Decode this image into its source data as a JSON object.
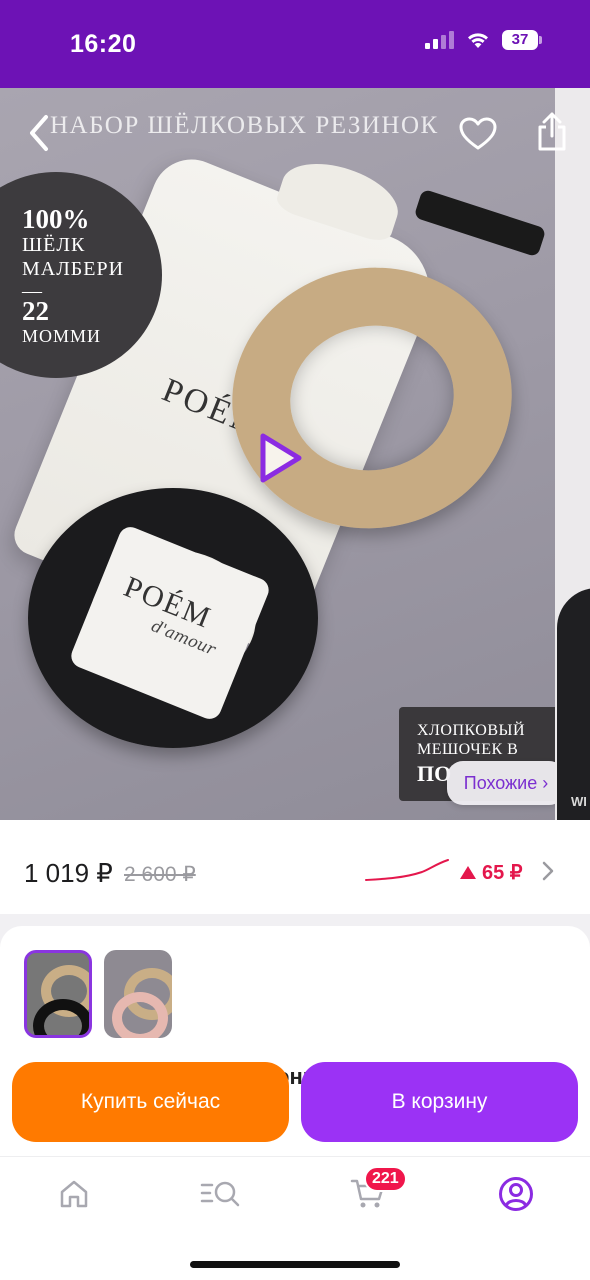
{
  "status_bar": {
    "time": "16:20",
    "battery": "37"
  },
  "product": {
    "photo_title": "НАБОР ШЁЛКОВЫХ РЕЗИНОК",
    "badge": {
      "line1": "100%",
      "line2": "ШЁЛК",
      "line3": "МАЛБЕРИ",
      "line4": "—",
      "line5": "22",
      "line6": "МОММИ"
    },
    "pouch_brand": "POÉM",
    "card_brand": "POÉM",
    "card_sub": "d'amour",
    "pouch_tag": {
      "line1": "ХЛОПКОВЫЙ",
      "line2": "МЕШОЧЕК В",
      "line3": "ПО"
    },
    "next_photo_label": "WI",
    "similar_label": "Похожие ›"
  },
  "pricing": {
    "price": "1 019 ₽",
    "old_price": "2 600 ₽",
    "price_change": "65 ₽",
    "trend_color": "#e4174c"
  },
  "thumbnails": [
    {
      "name": "photo-thumbnail-1",
      "selected": true
    },
    {
      "name": "photo-thumbnail-2",
      "selected": false
    }
  ],
  "peek_text": "онн",
  "actions": {
    "buy_now": "Купить сейчас",
    "add_to_cart": "В корзину"
  },
  "tabbar": {
    "items": [
      {
        "icon": "home-icon"
      },
      {
        "icon": "catalog-search-icon"
      },
      {
        "icon": "cart-icon"
      },
      {
        "icon": "profile-icon"
      }
    ],
    "cart_badge": "221"
  },
  "colors": {
    "status_bar": "#6d12b5",
    "accent": "#9b32f5",
    "buy": "#ff7a00",
    "price_up": "#e4174c"
  }
}
